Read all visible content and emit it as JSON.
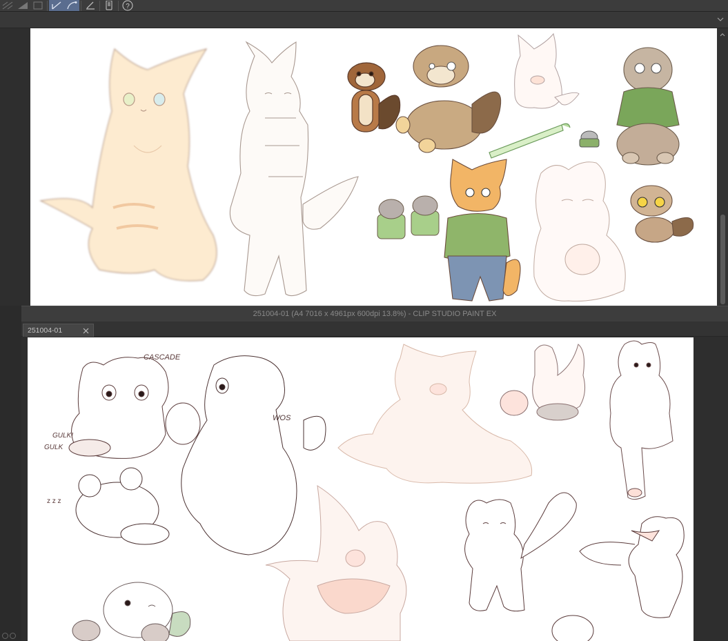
{
  "app": {
    "window_title": "251004-01 (A4 7016 x 4961px 600dpi 13.8%)  - CLIP STUDIO PAINT EX",
    "tab_label": "251004-01"
  },
  "toolbar": {
    "icons": [
      "ruler-hatch-icon",
      "ruler-fill-icon",
      "frame-icon",
      "pen-vector-icon",
      "curve-icon",
      "edit-ruler-icon",
      "smartphone-icon",
      "help-icon"
    ]
  },
  "colors": {
    "toolbar_bg": "#3c3c3c",
    "active_tool": "#5a6d8f",
    "workspace": "#2e2e2e",
    "paper": "#ffffff"
  },
  "doodles": {
    "sound1": "CASCADE",
    "sound2": "WOS",
    "gulp": "GULK!",
    "gulp2": "GULK",
    "zz": "z z z"
  }
}
